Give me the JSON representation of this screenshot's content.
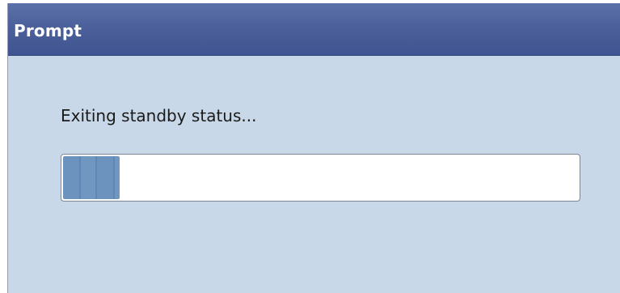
{
  "dialog": {
    "title": "Prompt",
    "message": "Exiting standby status...",
    "progress": 0.11
  }
}
